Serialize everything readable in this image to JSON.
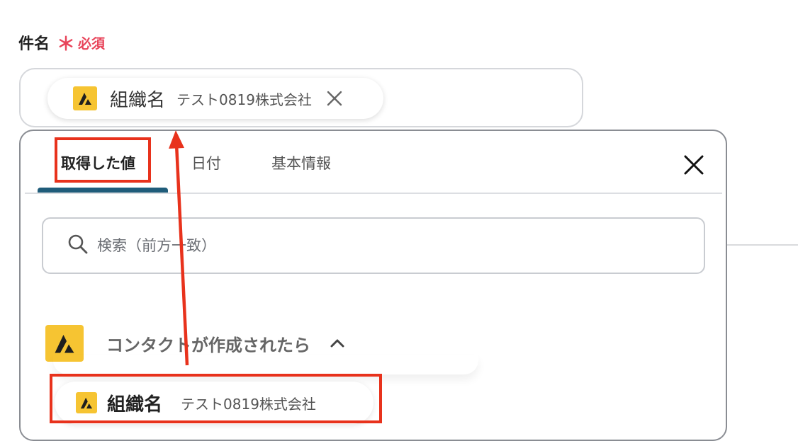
{
  "field": {
    "label": "件名",
    "required_mark": "＊",
    "required_text": "必須"
  },
  "token": {
    "icon": "app-logo-icon",
    "name": "組織名",
    "value": "テスト0819株式会社",
    "remove_icon": "close-icon"
  },
  "panel": {
    "tabs": [
      {
        "label": "取得した値",
        "active": true
      },
      {
        "label": "日付",
        "active": false
      },
      {
        "label": "基本情報",
        "active": false
      }
    ],
    "close_icon": "close-icon",
    "search": {
      "placeholder": "検索（前方一致）",
      "value": "",
      "icon": "search-icon"
    },
    "group": {
      "icon": "app-logo-icon",
      "title": "コンタクトが作成されたら",
      "chevron": "chevron-up-icon"
    },
    "item": {
      "icon": "app-logo-icon",
      "name": "組織名",
      "value": "テスト0819株式会社"
    }
  },
  "colors": {
    "required": "#e8445a",
    "annotation": "#e8321c",
    "tab_active": "#1f5c7a",
    "app_icon_bg": "#f6c432"
  }
}
